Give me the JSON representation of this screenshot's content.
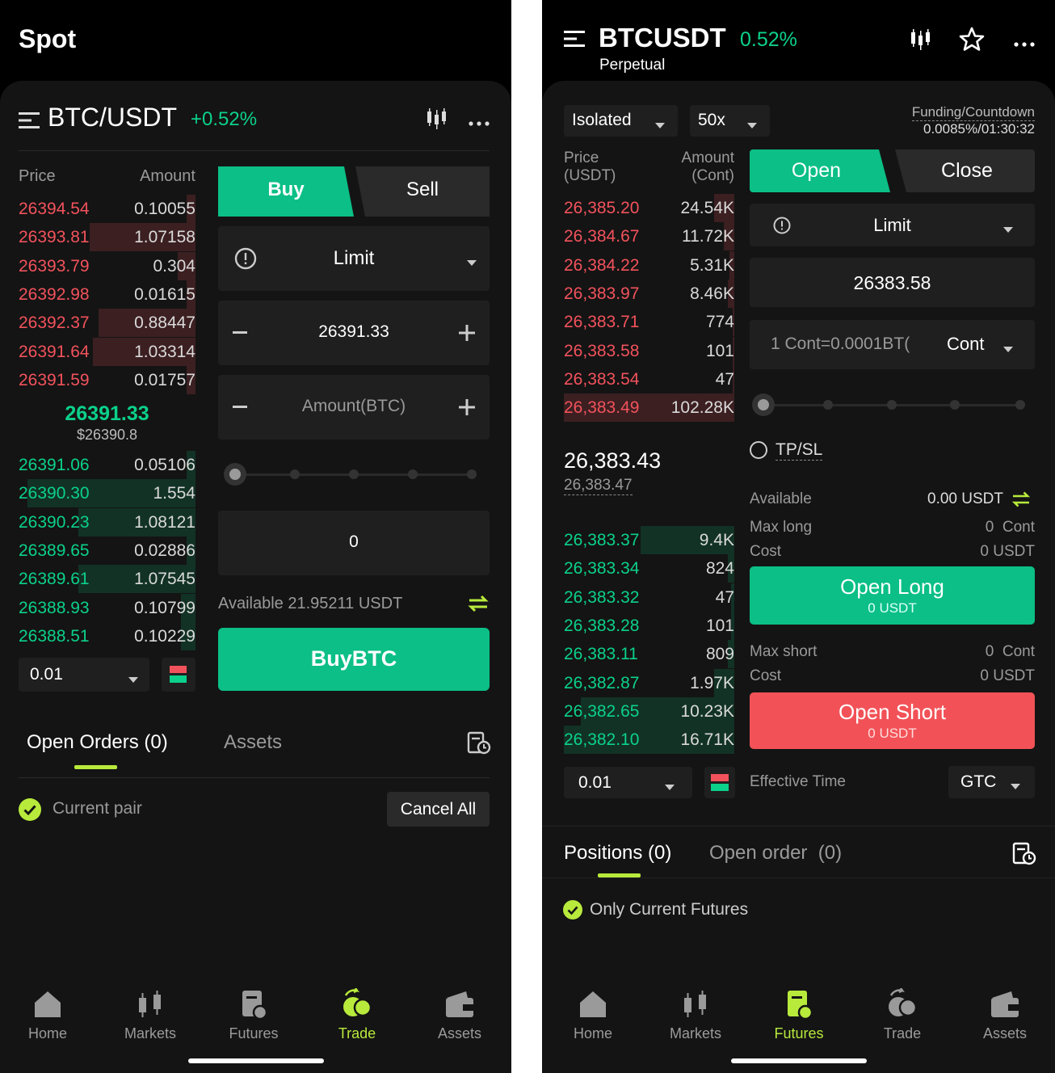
{
  "spot": {
    "title": "Spot",
    "pair": "BTC/USDT",
    "change": "+0.52%",
    "book_header": {
      "price": "Price",
      "amount": "Amount"
    },
    "asks": [
      {
        "price": "26394.54",
        "amount": "0.10055",
        "depth": 0.05
      },
      {
        "price": "26393.81",
        "amount": "1.07158",
        "depth": 0.6
      },
      {
        "price": "26393.79",
        "amount": "0.304",
        "depth": 0.1
      },
      {
        "price": "26392.98",
        "amount": "0.01615",
        "depth": 0.05
      },
      {
        "price": "26392.37",
        "amount": "0.88447",
        "depth": 0.55
      },
      {
        "price": "26391.64",
        "amount": "1.03314",
        "depth": 0.58
      },
      {
        "price": "26391.59",
        "amount": "0.01757",
        "depth": 0.05
      }
    ],
    "last_price": "26391.33",
    "last_price_usd": "$26390.8",
    "bids": [
      {
        "price": "26391.06",
        "amount": "0.05106",
        "depth": 0.05
      },
      {
        "price": "26390.30",
        "amount": "1.554",
        "depth": 0.95
      },
      {
        "price": "26390.23",
        "amount": "1.08121",
        "depth": 0.66
      },
      {
        "price": "26389.65",
        "amount": "0.02886",
        "depth": 0.05
      },
      {
        "price": "26389.61",
        "amount": "1.07545",
        "depth": 0.66
      },
      {
        "price": "26388.93",
        "amount": "0.10799",
        "depth": 0.08
      },
      {
        "price": "26388.51",
        "amount": "0.10229",
        "depth": 0.08
      }
    ],
    "precision": "0.01",
    "buy_tab": "Buy",
    "sell_tab": "Sell",
    "order_type": "Limit",
    "price_value": "26391.33",
    "amount_placeholder": "Amount(BTC)",
    "total_value": "0",
    "available": "Available 21.95211 USDT",
    "buy_button": "BuyBTC",
    "tab_open_orders": "Open Orders (0)",
    "tab_assets": "Assets",
    "current_pair": "Current pair",
    "cancel_all": "Cancel All"
  },
  "futures": {
    "symbol": "BTCUSDT",
    "change": "0.52%",
    "sub": "Perpetual",
    "margin_mode": "Isolated",
    "leverage": "50x",
    "funding_label": "Funding/Countdown",
    "funding_value": "0.0085%/01:30:32",
    "book_header": {
      "price": "Price",
      "price_unit": "(USDT)",
      "amount": "Amount",
      "amount_unit": "(Cont)"
    },
    "asks": [
      {
        "price": "26,385.20",
        "amount": "24.54K",
        "depth": 0.12
      },
      {
        "price": "26,384.67",
        "amount": "11.72K",
        "depth": 0.06
      },
      {
        "price": "26,384.22",
        "amount": "5.31K",
        "depth": 0.03
      },
      {
        "price": "26,383.97",
        "amount": "8.46K",
        "depth": 0.04
      },
      {
        "price": "26,383.71",
        "amount": "774",
        "depth": 0.01
      },
      {
        "price": "26,383.58",
        "amount": "101",
        "depth": 0.01
      },
      {
        "price": "26,383.54",
        "amount": "47",
        "depth": 0.01
      },
      {
        "price": "26,383.49",
        "amount": "102.28K",
        "depth": 1.0
      }
    ],
    "last_price": "26,383.43",
    "mark_price": "26,383.47",
    "bids": [
      {
        "price": "26,383.37",
        "amount": "9.4K",
        "depth": 0.55
      },
      {
        "price": "26,383.34",
        "amount": "824",
        "depth": 0.04
      },
      {
        "price": "26,383.32",
        "amount": "47",
        "depth": 0.02
      },
      {
        "price": "26,383.28",
        "amount": "101",
        "depth": 0.02
      },
      {
        "price": "26,383.11",
        "amount": "809",
        "depth": 0.04
      },
      {
        "price": "26,382.87",
        "amount": "1.97K",
        "depth": 0.12
      },
      {
        "price": "26,382.65",
        "amount": "10.23K",
        "depth": 0.9
      },
      {
        "price": "26,382.10",
        "amount": "16.71K",
        "depth": 1.0
      }
    ],
    "precision": "0.01",
    "open_tab": "Open",
    "close_tab": "Close",
    "order_type": "Limit",
    "price_value": "26383.58",
    "amount_placeholder": "1 Cont=0.0001BT(",
    "unit": "Cont",
    "tpsl": "TP/SL",
    "available_label": "Available",
    "available_value": "0.00 USDT",
    "max_long_label": "Max long",
    "max_long_value": "0  Cont",
    "cost_label": "Cost",
    "long_cost_value": "0 USDT",
    "open_long": "Open Long",
    "open_long_sub": "0 USDT",
    "max_short_label": "Max short",
    "max_short_value": "0  Cont",
    "short_cost_value": "0 USDT",
    "open_short": "Open Short",
    "open_short_sub": "0 USDT",
    "effective_label": "Effective Time",
    "effective_value": "GTC",
    "tab_positions": "Positions (0)",
    "tab_open_order": "Open order  (0)",
    "only_current": "Only Current Futures"
  },
  "nav": {
    "home": "Home",
    "markets": "Markets",
    "futures": "Futures",
    "trade": "Trade",
    "assets": "Assets"
  },
  "colors": {
    "green": "#0bd18a",
    "red": "#f2525c",
    "accent": "#b8ea3c",
    "button_green": "#0bbf86"
  }
}
